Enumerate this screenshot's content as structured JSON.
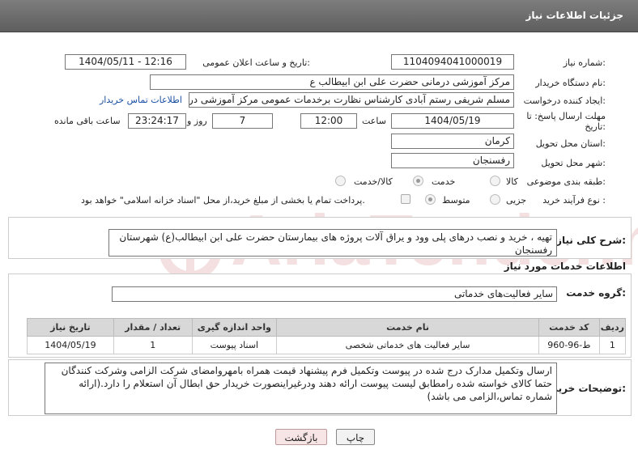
{
  "header": {
    "title": "جزئیات اطلاعات نیاز"
  },
  "form": {
    "need_number": {
      "label": "شماره نیاز:",
      "value": "1104094041000019"
    },
    "announce": {
      "label": "تاریخ و ساعت اعلان عمومی:",
      "value": "1404/05/11 - 12:16"
    },
    "buyer_org": {
      "label": "نام دستگاه خریدار:",
      "value": "مرکز آموزشی  درمانی حضرت علی ابن ابیطالب ع"
    },
    "requester": {
      "label": "ایجاد کننده درخواست:",
      "value": "مسلم شریفی رستم آبادی کارشناس نظارت برخدمات عمومی مرکز آموزشی  در",
      "contact_link": "اطلاعات تماس خریدار"
    },
    "deadline": {
      "label_line1": "مهلت ارسال پاسخ: تا",
      "label_line2": "تاریخ:",
      "date": "1404/05/19",
      "time_label": "ساعت",
      "time": "12:00",
      "days": "7",
      "days_label": "روز و",
      "remaining": "23:24:17",
      "remaining_label": "ساعت باقی مانده"
    },
    "province": {
      "label": "استان محل تحویل:",
      "value": "کرمان"
    },
    "city": {
      "label": "شهر محل تحویل:",
      "value": "رفسنجان"
    },
    "category": {
      "label": "طبقه بندی موضوعی:",
      "options": [
        "کالا",
        "خدمت",
        "کالا/خدمت"
      ]
    },
    "process": {
      "label": "نوع فرآیند خرید :",
      "options": [
        "جزیی",
        "متوسط"
      ],
      "note": "پرداخت تمام یا بخشی از مبلغ خرید،از محل \"اسناد خزانه اسلامی\" خواهد بود."
    }
  },
  "summary": {
    "label": "شرح کلی نیاز:",
    "text": "تهیه ، خرید و نصب درهای پلی وود و یراق آلات پروژه های بیمارستان حضرت علی ابن ابیطالب(ع) شهرستان رفسنجان"
  },
  "services": {
    "section_title": "اطلاعات خدمات مورد نیاز",
    "group_label": "گروه خدمت:",
    "group_value": "سایر فعالیت‌های خدماتی",
    "table": {
      "headers": [
        "ردیف",
        "کد خدمت",
        "نام خدمت",
        "واحد اندازه گیری",
        "تعداد / مقدار",
        "تاریخ نیاز"
      ],
      "rows": [
        [
          "1",
          "ط-96-960",
          "سایر فعالیت های خدماتی شخصی",
          "اسناد پیوست",
          "1",
          "1404/05/19"
        ]
      ]
    }
  },
  "buyer_notes": {
    "label": "توضیحات خریدار:",
    "text": "ارسال وتکمیل مدارک درج شده در پیوست وتکمیل فرم پیشنهاد قیمت همراه بامهروامضای شرکت الزامی وشرکت کنندگان حتما کالای خواسته شده رامطابق لیست پیوست ارائه دهند ودرغیراینصورت خریدار حق ابطال آن استعلام را دارد.(ارائه شماره تماس،الزامی می باشد)"
  },
  "buttons": {
    "print": "چاپ",
    "back": "بازگشت"
  },
  "watermark": {
    "text": "AriaTender.net"
  }
}
